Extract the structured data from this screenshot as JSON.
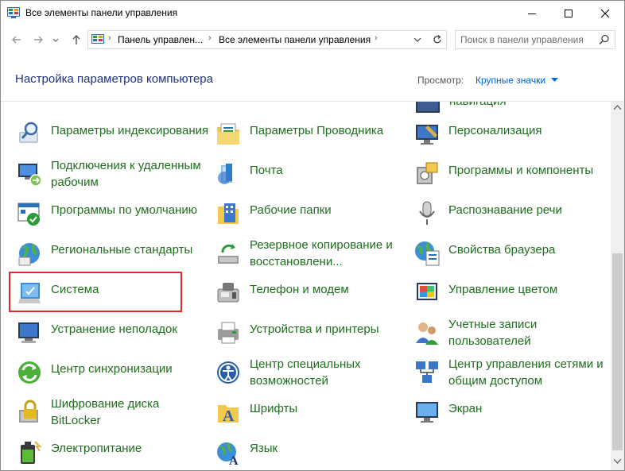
{
  "window": {
    "title": "Все элементы панели управления",
    "icon": "control-panel-icon",
    "buttons": [
      "minimize-icon",
      "maximize-icon",
      "close-icon"
    ]
  },
  "nav": {
    "back": "arrow-left-icon",
    "forward": "arrow-right-icon",
    "recent": "chevron-down-icon",
    "up": "arrow-up-icon",
    "breadcrumb": [
      "Панель управлен...",
      "Все элементы панели управления"
    ],
    "refresh": "refresh-icon",
    "search_placeholder": "Поиск в панели управления"
  },
  "header": {
    "title": "Настройка параметров компьютера",
    "view_label": "Просмотр:",
    "view_value": "Крупные значки"
  },
  "partial_item": {
    "label": "навигация",
    "icon": "navigation-icon"
  },
  "items": [
    {
      "label": "Параметры индексирования",
      "icon": "indexing-options-icon"
    },
    {
      "label": "Параметры Проводника",
      "icon": "explorer-options-icon"
    },
    {
      "label": "Персонализация",
      "icon": "personalization-icon"
    },
    {
      "label": "Подключения к удаленным рабочим",
      "icon": "remote-desktop-icon"
    },
    {
      "label": "Почта",
      "icon": "mail-icon"
    },
    {
      "label": "Программы и компоненты",
      "icon": "programs-features-icon"
    },
    {
      "label": "Программы по умолчанию",
      "icon": "default-programs-icon"
    },
    {
      "label": "Рабочие папки",
      "icon": "work-folders-icon"
    },
    {
      "label": "Распознавание речи",
      "icon": "speech-recognition-icon"
    },
    {
      "label": "Региональные стандарты",
      "icon": "region-icon"
    },
    {
      "label": "Резервное копирование и восстановлени...",
      "icon": "backup-restore-icon"
    },
    {
      "label": "Свойства браузера",
      "icon": "internet-options-icon"
    },
    {
      "label": "Система",
      "icon": "system-icon",
      "highlighted": true
    },
    {
      "label": "Телефон и модем",
      "icon": "phone-modem-icon"
    },
    {
      "label": "Управление цветом",
      "icon": "color-management-icon"
    },
    {
      "label": "Устранение неполадок",
      "icon": "troubleshooting-icon"
    },
    {
      "label": "Устройства и принтеры",
      "icon": "devices-printers-icon"
    },
    {
      "label": "Учетные записи пользователей",
      "icon": "user-accounts-icon"
    },
    {
      "label": "Центр синхронизации",
      "icon": "sync-center-icon"
    },
    {
      "label": "Центр специальных возможностей",
      "icon": "ease-of-access-icon"
    },
    {
      "label": "Центр управления сетями и общим доступом",
      "icon": "network-sharing-icon"
    },
    {
      "label": "Шифрование диска BitLocker",
      "icon": "bitlocker-icon"
    },
    {
      "label": "Шрифты",
      "icon": "fonts-icon"
    },
    {
      "label": "Экран",
      "icon": "display-icon"
    },
    {
      "label": "Электропитание",
      "icon": "power-options-icon"
    },
    {
      "label": "Язык",
      "icon": "language-icon"
    }
  ],
  "colors": {
    "item_text": "#1e6e1e",
    "title_text": "#1e3287",
    "link": "#0066cc",
    "highlight_border": "#e0282e"
  }
}
